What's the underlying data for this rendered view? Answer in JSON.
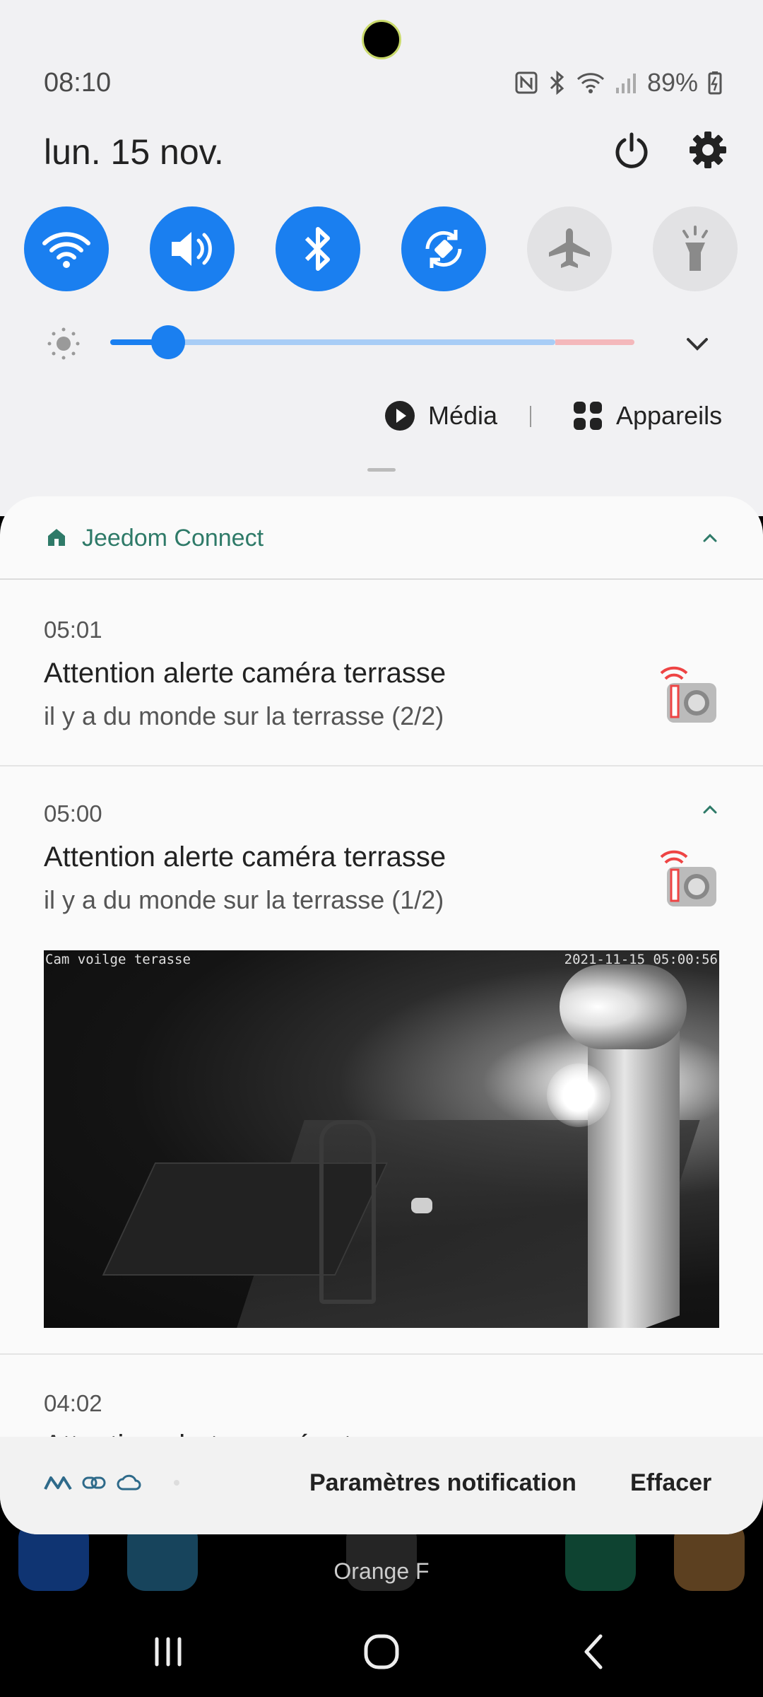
{
  "status_bar": {
    "time": "08:10",
    "battery": "89%"
  },
  "quick_panel": {
    "date": "lun. 15 nov.",
    "toggles": [
      {
        "name": "wifi",
        "state": "on"
      },
      {
        "name": "sound",
        "state": "on"
      },
      {
        "name": "bluetooth",
        "state": "on"
      },
      {
        "name": "auto-rotate",
        "state": "on"
      },
      {
        "name": "airplane-mode",
        "state": "off"
      },
      {
        "name": "flashlight",
        "state": "off"
      }
    ],
    "brightness_level": 0.11,
    "media_label": "Média",
    "devices_label": "Appareils",
    "accent_color": "#1a7ff0"
  },
  "notification_group": {
    "app_name": "Jeedom Connect",
    "app_color": "#2e7a68",
    "items": [
      {
        "time": "05:01",
        "title": "Attention alerte caméra terrasse",
        "body": "il y a du monde sur la terrasse (2/2)"
      },
      {
        "time": "05:00",
        "title": "Attention alerte caméra terrasse",
        "body": "il y a du monde sur la terrasse (1/2)",
        "image_overlay_left": "Cam voilge terasse",
        "image_overlay_right": "2021-11-15 05:00:56"
      },
      {
        "time": "04:02",
        "title": "Attention alerte caméra terrasse"
      }
    ]
  },
  "footer": {
    "settings_label": "Paramètres notification",
    "clear_label": "Effacer"
  },
  "home": {
    "carrier": "Orange F"
  }
}
